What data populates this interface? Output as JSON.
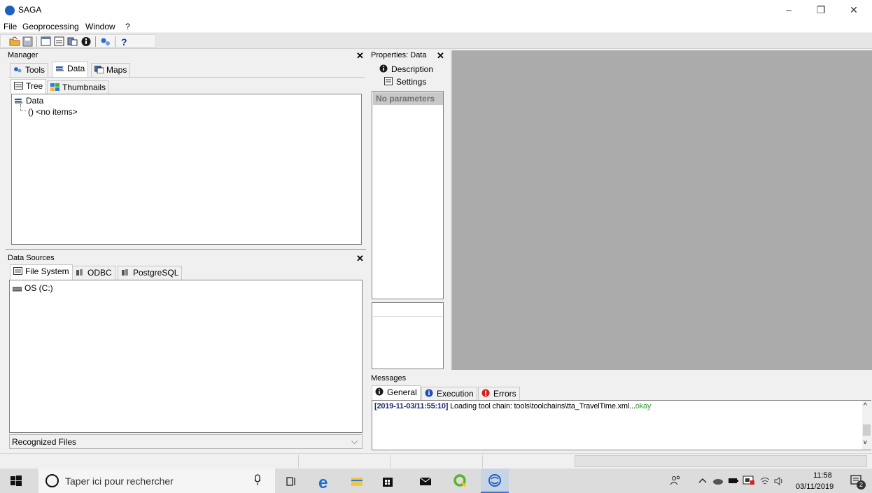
{
  "window": {
    "title": "SAGA",
    "controls": {
      "minimize": "–",
      "restore": "❐",
      "close": "✕"
    }
  },
  "menu": [
    "File",
    "Geoprocessing",
    "Window",
    "?"
  ],
  "manager": {
    "title": "Manager",
    "close": "✕",
    "tabs": [
      "Tools",
      "Data",
      "Maps"
    ],
    "subtabs": [
      "Tree",
      "Thumbnails"
    ],
    "tree": {
      "root": "Data",
      "child": "() <no items>"
    }
  },
  "data_sources": {
    "title": "Data Sources",
    "close": "✕",
    "tabs": [
      "File System",
      "ODBC",
      "PostgreSQL"
    ],
    "drive": "OS (C:)",
    "footer_select": "Recognized Files",
    "footer_arrow": "⌵"
  },
  "properties": {
    "title": "Properties: Data",
    "close": "✕",
    "buttons": [
      "Description",
      "Settings"
    ],
    "placeholder": "No parameters"
  },
  "messages": {
    "title": "Messages",
    "tabs": [
      "General",
      "Execution",
      "Errors"
    ],
    "log": {
      "timestamp": "[2019-11-03/11:55:10]",
      "text": " Loading tool chain: tools\\toolchains\\tta_TravelTime.xml...",
      "status": "okay"
    },
    "scroll_up": "^",
    "scroll_down": "v"
  },
  "taskbar": {
    "search_placeholder": "Taper ici pour rechercher",
    "time": "11:58",
    "date": "03/11/2019",
    "notifications": "2"
  },
  "colors": {
    "workspace": "#ababab",
    "ok_green": "#2c9e2c",
    "qgis_green": "#59b32c",
    "saga_blue": "#1e5fbf",
    "error_red": "#d62020"
  }
}
